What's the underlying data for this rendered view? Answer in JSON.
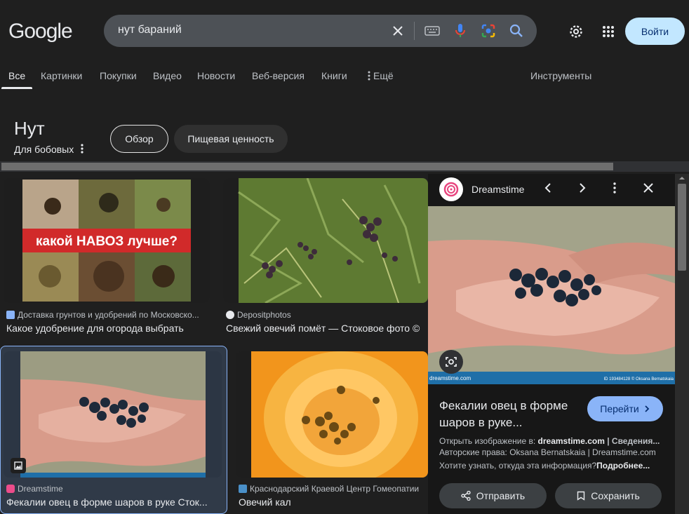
{
  "header": {
    "logo": "Google",
    "query": "нут бараний",
    "signin_label": "Войти"
  },
  "tabs": [
    {
      "label": "Все",
      "active": true
    },
    {
      "label": "Картинки"
    },
    {
      "label": "Покупки"
    },
    {
      "label": "Видео"
    },
    {
      "label": "Новости"
    },
    {
      "label": "Веб-версия"
    },
    {
      "label": "Книги"
    },
    {
      "label": "Ещё"
    }
  ],
  "tools_label": "Инструменты",
  "knowledge": {
    "title": "Нут",
    "subtitle": "Для бобовых",
    "chips": [
      "Обзор",
      "Пищевая ценность"
    ]
  },
  "results": [
    {
      "source": "Доставка грунтов и удобрений по Московско...",
      "caption": "Какое удобрение для огорода выбрать",
      "image_text": "какой НАВОЗ лучше?"
    },
    {
      "source": "Depositphotos",
      "caption": "Свежий овечий помёт — Стоковое фото ©"
    },
    {
      "source": "Dreamstime",
      "caption": "Фекалии овец в форме шаров в руке Сток..."
    },
    {
      "source": "Краснодарский Краевой Центр Гомеопатии",
      "caption": "Овечий кал"
    }
  ],
  "panel": {
    "site": "Dreamstime",
    "title_line1": "Фекалии овец в форме",
    "title_line2": "шаров в руке...",
    "visit_label": "Перейти",
    "open_prefix": "Открыть изображение в: ",
    "open_site": "dreamstime.com",
    "open_suffix": " | Сведения...",
    "copyright": "Авторские права: Oksana Bernatskaia | Dreamstime.com",
    "more_q": "Хотите узнать, откуда эта информация?",
    "more_link": "Подробнее...",
    "share_label": "Отправить",
    "save_label": "Сохранить",
    "watermark": "dreamstime.com",
    "image_id": "ID 193484128 © Oksana Bernatskaia"
  },
  "colors": {
    "bg": "#1f1f1f",
    "accent": "#c2e7ff",
    "chip_bg": "#303030"
  }
}
